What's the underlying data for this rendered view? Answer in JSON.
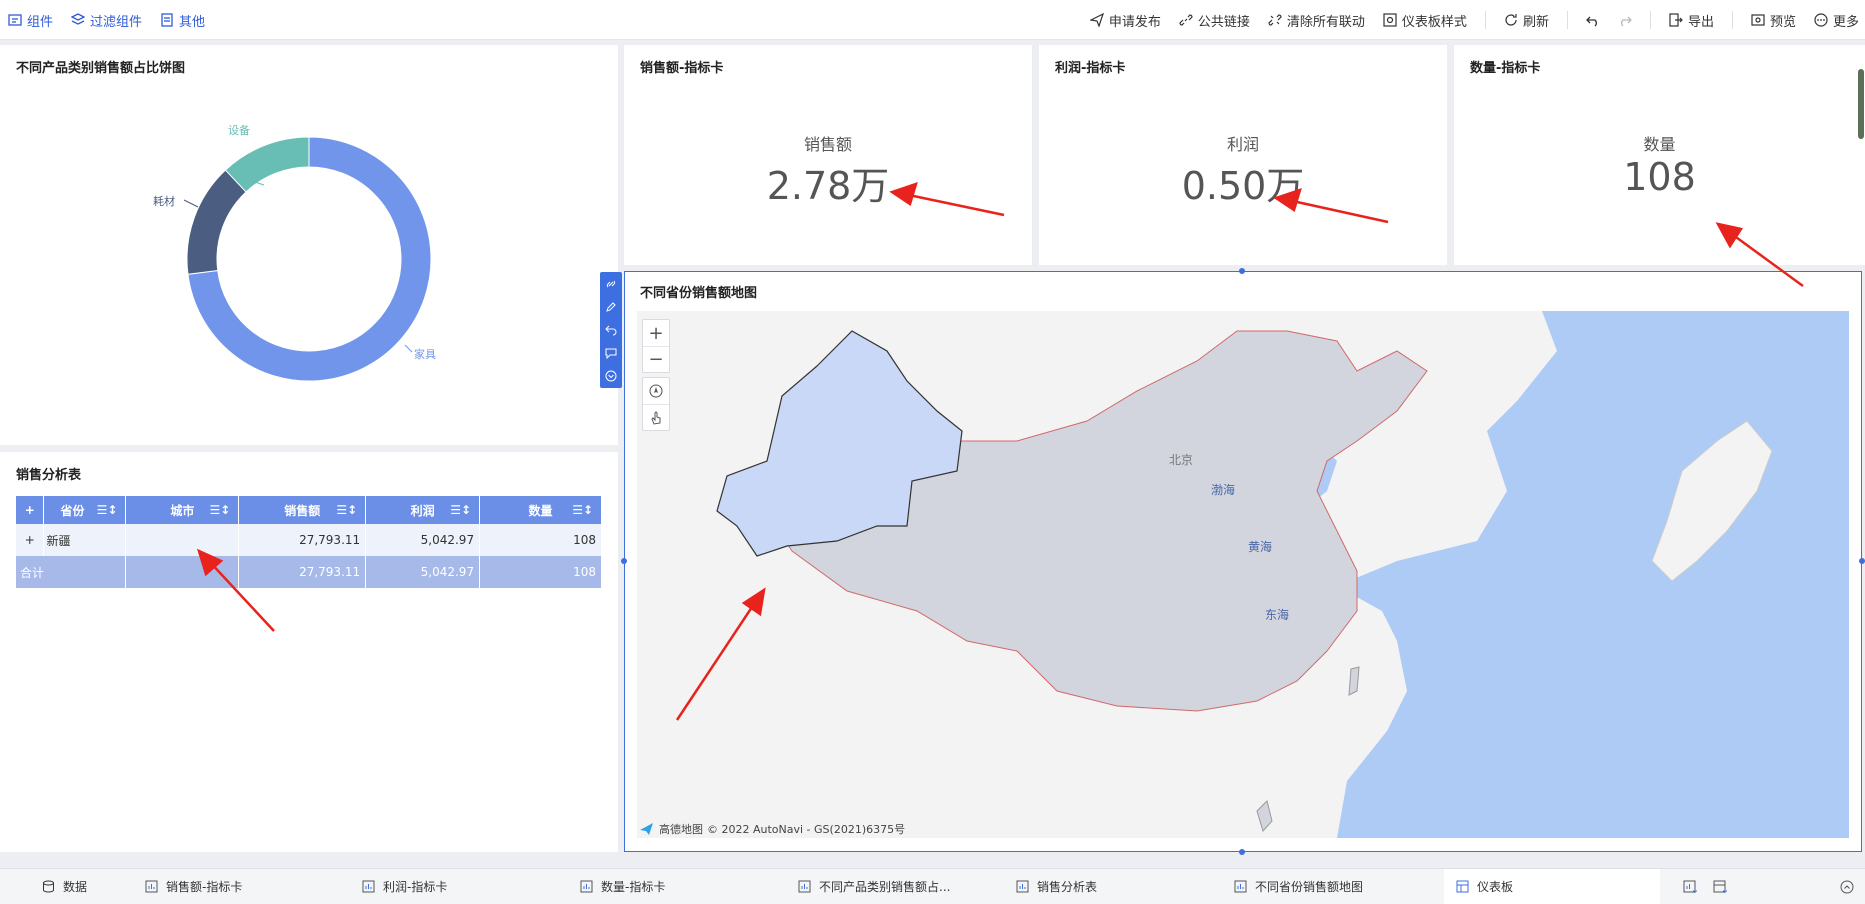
{
  "toolbar": {
    "left": [
      {
        "label": "组件",
        "icon": "component-icon"
      },
      {
        "label": "过滤组件",
        "icon": "filter-icon"
      },
      {
        "label": "其他",
        "icon": "other-icon"
      }
    ],
    "right": [
      {
        "label": "申请发布",
        "icon": "send-icon"
      },
      {
        "label": "公共链接",
        "icon": "link-icon"
      },
      {
        "label": "清除所有联动",
        "icon": "unlink-icon"
      },
      {
        "label": "仪表板样式",
        "icon": "style-icon"
      },
      {
        "label": "刷新",
        "icon": "refresh-icon"
      },
      {
        "label": "导出",
        "icon": "export-icon"
      },
      {
        "label": "预览",
        "icon": "preview-icon"
      },
      {
        "label": "更多",
        "icon": "more-icon"
      }
    ]
  },
  "pie_panel": {
    "title": "不同产品类别销售额占比饼图",
    "labels": {
      "equipment": "设备",
      "consumables": "耗材",
      "furniture": "家具"
    }
  },
  "chart_data": {
    "type": "pie",
    "donut": true,
    "series": [
      {
        "name": "家具",
        "value": 0.73,
        "color": "#7095ea"
      },
      {
        "name": "耗材",
        "value": 0.15,
        "color": "#4b5d80"
      },
      {
        "name": "设备",
        "value": 0.12,
        "color": "#68bdb4"
      }
    ]
  },
  "kpi_cards": [
    {
      "title": "销售额-指标卡",
      "label": "销售额",
      "value": "2.78万"
    },
    {
      "title": "利润-指标卡",
      "label": "利润",
      "value": "0.50万"
    },
    {
      "title": "数量-指标卡",
      "label": "数量",
      "value": "108"
    }
  ],
  "table_panel": {
    "title": "销售分析表",
    "headers": [
      "省份",
      "城市",
      "销售额",
      "利润",
      "数量"
    ],
    "expand_symbol": "+",
    "rows": [
      {
        "province": "新疆",
        "city": "",
        "sales": "27,793.11",
        "profit": "5,042.97",
        "qty": "108"
      }
    ],
    "total": {
      "label": "合计",
      "sales": "27,793.11",
      "profit": "5,042.97",
      "qty": "108"
    }
  },
  "map_panel": {
    "title": "不同省份销售额地图",
    "zoom_in": "+",
    "zoom_out": "−",
    "place_labels": {
      "beijing": "北京",
      "bohai": "渤海",
      "huanghai": "黄海",
      "donghai": "东海"
    },
    "attribution_brand": "高德地图",
    "attribution": "© 2022 AutoNavi - GS(2021)6375号",
    "colors": {
      "ocean": "#aecbf6",
      "land": "#f3f3f3",
      "china": "#d3d5de",
      "xinjiang": "#c9d8f6"
    }
  },
  "bottom_tabs": [
    {
      "label": "数据",
      "icon": "database-icon"
    },
    {
      "label": "销售额-指标卡",
      "icon": "chart-icon"
    },
    {
      "label": "利润-指标卡",
      "icon": "chart-icon"
    },
    {
      "label": "数量-指标卡",
      "icon": "chart-icon"
    },
    {
      "label": "不同产品类别销售额占...",
      "icon": "chart-icon"
    },
    {
      "label": "销售分析表",
      "icon": "chart-icon"
    },
    {
      "label": "不同省份销售额地图",
      "icon": "chart-icon"
    },
    {
      "label": "仪表板",
      "icon": "dashboard-icon"
    }
  ],
  "colors": {
    "accent": "#3e6fe0",
    "table_header": "#6b8ee6",
    "arrow": "#e8221c"
  }
}
